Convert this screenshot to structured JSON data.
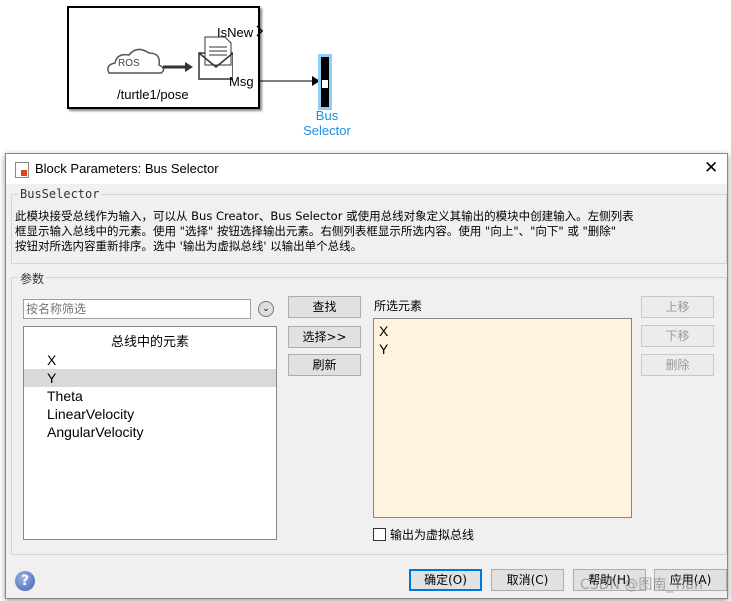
{
  "canvas": {
    "ros_label": "ROS",
    "topic": "/turtle1/pose",
    "port_isnew": "IsNew",
    "port_msg": "Msg",
    "bus_selector_label_1": "Bus",
    "bus_selector_label_2": "Selector"
  },
  "dialog": {
    "title": "Block Parameters: Bus Selector",
    "desc_group": "BusSelector",
    "description": [
      "此模块接受总线作为输入，可以从 Bus Creator、Bus Selector 或使用总线对象定义其输出的模块中创建输入。左侧列表",
      "框显示输入总线中的元素。使用 \"选择\" 按钮选择输出元素。右侧列表框显示所选内容。使用 \"向上\"、\"向下\" 或 \"删除\"",
      "按钮对所选内容重新排序。选中 '输出为虚拟总线' 以输出单个总线。"
    ],
    "params_group": "参数",
    "filter_placeholder": "按名称筛选",
    "left_list_header": "总线中的元素",
    "left_items": [
      "X",
      "Y",
      "Theta",
      "LinearVelocity",
      "AngularVelocity"
    ],
    "find": "查找",
    "select": "选择>>",
    "refresh": "刷新",
    "selected_label": "所选元素",
    "selected_items": [
      "X",
      "Y"
    ],
    "up": "上移",
    "down": "下移",
    "delete": "删除",
    "virtual_bus": "输出为虚拟总线",
    "ok": "确定(O)",
    "cancel": "取消(C)",
    "help": "帮助(H)",
    "apply": "应用(A)"
  },
  "watermark": "CSDN @图南_Tian"
}
